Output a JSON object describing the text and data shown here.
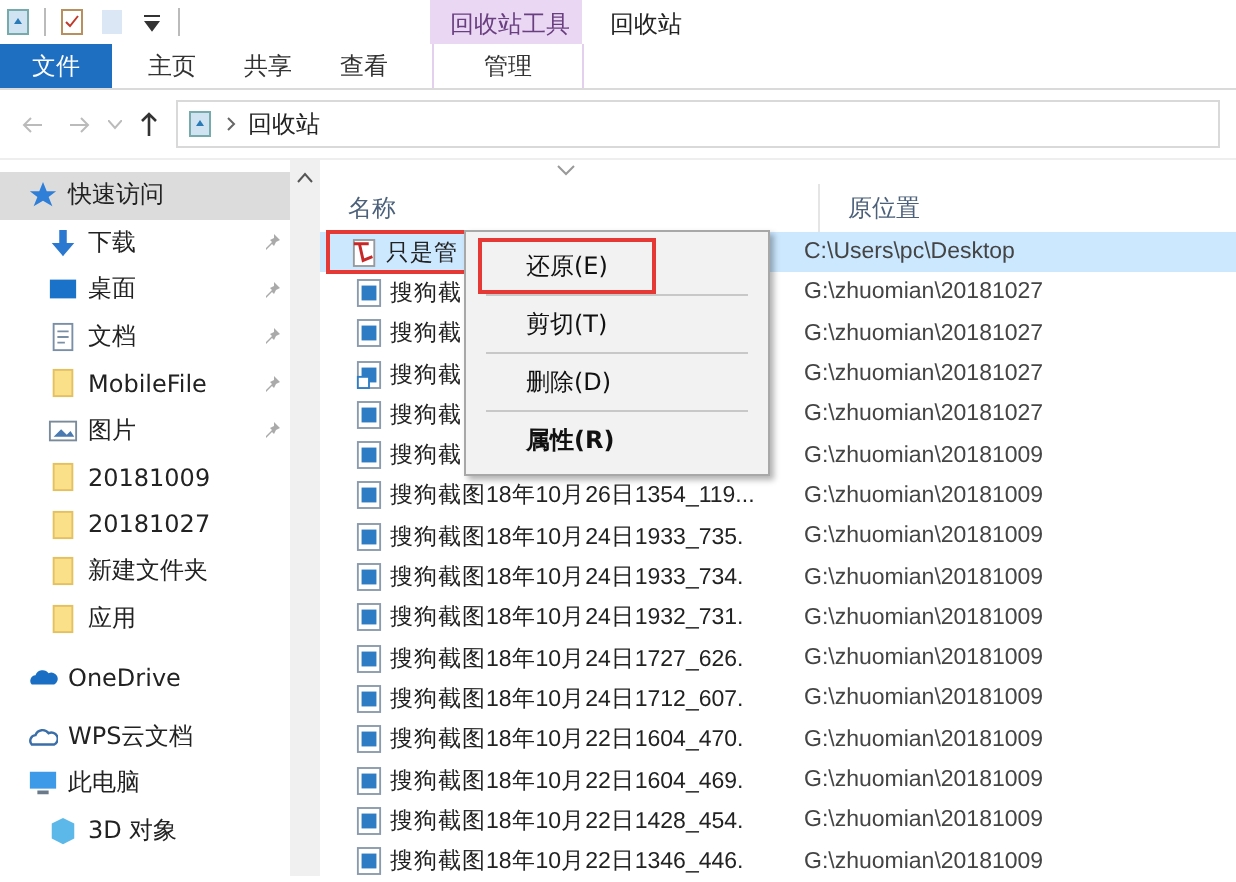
{
  "titlebar": {
    "context_tab_header": "回收站工具",
    "title": "回收站"
  },
  "ribbon_tabs": [
    {
      "label": "文件",
      "kind": "file"
    },
    {
      "label": "主页",
      "kind": "normal"
    },
    {
      "label": "共享",
      "kind": "normal"
    },
    {
      "label": "查看",
      "kind": "normal"
    },
    {
      "label": "管理",
      "kind": "contextual"
    }
  ],
  "address_bar": {
    "path": "回收站"
  },
  "sidebar": {
    "items": [
      {
        "label": "快速访问",
        "kind": "star",
        "selected": true,
        "children": [
          {
            "label": "下载",
            "kind": "download",
            "pinned": true,
            "selected": false
          },
          {
            "label": "桌面",
            "kind": "desktop",
            "pinned": true,
            "selected": false
          },
          {
            "label": "文档",
            "kind": "document",
            "pinned": true,
            "selected": false
          },
          {
            "label": "MobileFile",
            "kind": "folder",
            "pinned": true,
            "selected": false
          },
          {
            "label": "图片",
            "kind": "pictures",
            "pinned": true,
            "selected": false
          },
          {
            "label": "20181009",
            "kind": "folder",
            "pinned": false,
            "selected": false
          },
          {
            "label": "20181027",
            "kind": "folder",
            "pinned": false,
            "selected": false
          },
          {
            "label": "新建文件夹",
            "kind": "folder",
            "pinned": false,
            "selected": false
          },
          {
            "label": "应用",
            "kind": "folder",
            "pinned": false,
            "selected": false
          }
        ]
      },
      {
        "label": "OneDrive",
        "kind": "cloud",
        "selected": false
      },
      {
        "label": "WPS云文档",
        "kind": "cloud-outline",
        "selected": false
      },
      {
        "label": "此电脑",
        "kind": "pc",
        "selected": false,
        "children": [
          {
            "label": "3D 对象",
            "kind": "cube",
            "selected": false
          }
        ]
      }
    ]
  },
  "table": {
    "columns": [
      "名称",
      "原位置"
    ],
    "rows": [
      {
        "name": "只是管",
        "location": "C:\\Users\\pc\\Desktop",
        "kind": "pdf",
        "selected": true,
        "highlighted": true
      },
      {
        "name": "搜狗截",
        "location": "G:\\zhuomian\\20181027",
        "kind": "image",
        "selected": false,
        "highlighted": false
      },
      {
        "name": "搜狗截",
        "location": "G:\\zhuomian\\20181027",
        "kind": "image",
        "selected": false,
        "highlighted": false
      },
      {
        "name": "搜狗截",
        "location": "G:\\zhuomian\\20181027",
        "kind": "shortcut",
        "selected": false,
        "highlighted": false
      },
      {
        "name": "搜狗截",
        "location": "G:\\zhuomian\\20181027",
        "kind": "image",
        "selected": false,
        "highlighted": false
      },
      {
        "name": "搜狗截",
        "location": "G:\\zhuomian\\20181009",
        "kind": "image",
        "selected": false,
        "highlighted": false
      },
      {
        "name": "搜狗截图18年10月26日1354_119...",
        "location": "G:\\zhuomian\\20181009",
        "kind": "image",
        "selected": false,
        "highlighted": false
      },
      {
        "name": "搜狗截图18年10月24日1933_735.",
        "location": "G:\\zhuomian\\20181009",
        "kind": "image",
        "selected": false,
        "highlighted": false
      },
      {
        "name": "搜狗截图18年10月24日1933_734.",
        "location": "G:\\zhuomian\\20181009",
        "kind": "image",
        "selected": false,
        "highlighted": false
      },
      {
        "name": "搜狗截图18年10月24日1932_731.",
        "location": "G:\\zhuomian\\20181009",
        "kind": "image",
        "selected": false,
        "highlighted": false
      },
      {
        "name": "搜狗截图18年10月24日1727_626.",
        "location": "G:\\zhuomian\\20181009",
        "kind": "image",
        "selected": false,
        "highlighted": false
      },
      {
        "name": "搜狗截图18年10月24日1712_607.",
        "location": "G:\\zhuomian\\20181009",
        "kind": "image",
        "selected": false,
        "highlighted": false
      },
      {
        "name": "搜狗截图18年10月22日1604_470.",
        "location": "G:\\zhuomian\\20181009",
        "kind": "image",
        "selected": false,
        "highlighted": false
      },
      {
        "name": "搜狗截图18年10月22日1604_469.",
        "location": "G:\\zhuomian\\20181009",
        "kind": "image",
        "selected": false,
        "highlighted": false
      },
      {
        "name": "搜狗截图18年10月22日1428_454.",
        "location": "G:\\zhuomian\\20181009",
        "kind": "image",
        "selected": false,
        "highlighted": false
      },
      {
        "name": "搜狗截图18年10月22日1346_446.",
        "location": "G:\\zhuomian\\20181009",
        "kind": "image",
        "selected": false,
        "highlighted": false
      }
    ]
  },
  "context_menu": {
    "items": [
      {
        "label": "还原(E)",
        "bold": false,
        "highlighted": true
      },
      {
        "label": "剪切(T)",
        "bold": false,
        "highlighted": false
      },
      {
        "label": "删除(D)",
        "bold": false,
        "highlighted": false
      },
      {
        "label": "属性(R)",
        "bold": true,
        "highlighted": false
      }
    ]
  }
}
